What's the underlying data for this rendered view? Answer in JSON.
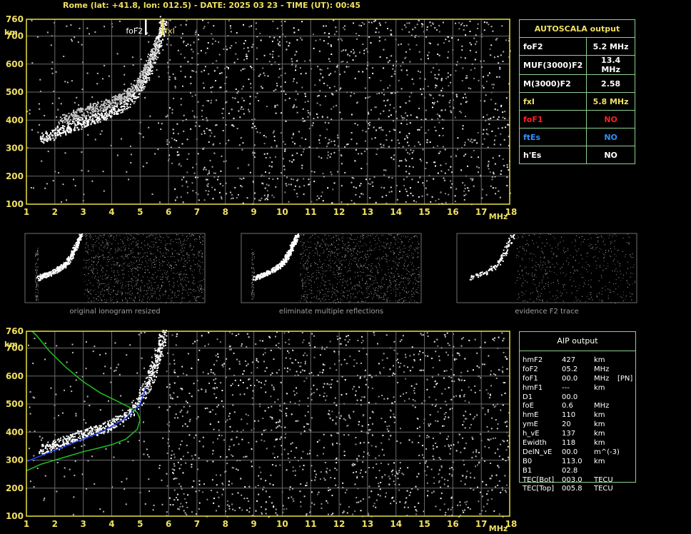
{
  "header": {
    "title": "Rome (lat: +41.8, lon: 012.5) - DATE: 2025 03 23 - TIME (UT): 00:45"
  },
  "chart_data": [
    {
      "type": "scatter",
      "title": "",
      "xlabel": "MHz",
      "ylabel": "km",
      "xlim": [
        1,
        18
      ],
      "ylim": [
        100,
        760
      ],
      "x_ticks": [
        "1",
        "2",
        "3",
        "4",
        "5",
        "6",
        "7",
        "8",
        "9",
        "10",
        "11",
        "12",
        "13",
        "14",
        "15",
        "16",
        "17",
        "18"
      ],
      "y_ticks": [
        "760",
        "700",
        "600",
        "500",
        "400",
        "300",
        "200",
        "100"
      ],
      "grid": true,
      "annotations": [
        {
          "text": "foF2",
          "x": 5.2,
          "color": "#ffffff"
        },
        {
          "text": "fxI",
          "x": 5.8,
          "color": "#f0e060"
        }
      ],
      "series": [
        {
          "x": [
            1.5,
            2.0,
            2.5,
            3.0,
            3.5,
            4.0,
            4.5,
            5.0,
            5.3,
            5.5,
            5.7,
            5.8
          ],
          "y": [
            335,
            355,
            375,
            395,
            410,
            430,
            460,
            520,
            580,
            640,
            700,
            760
          ],
          "color": "#ffffff"
        },
        {
          "x": [
            2.2,
            2.7,
            3.2,
            3.7,
            4.2,
            4.6,
            5.0,
            5.3,
            5.6
          ],
          "y": [
            400,
            420,
            440,
            455,
            475,
            500,
            540,
            600,
            680
          ],
          "color": "#c8c8c8"
        }
      ]
    },
    {
      "type": "scatter",
      "title": "",
      "xlabel": "MHz",
      "ylabel": "km",
      "xlim": [
        1,
        18
      ],
      "ylim": [
        100,
        760
      ],
      "x_ticks": [
        "1",
        "2",
        "3",
        "4",
        "5",
        "6",
        "7",
        "8",
        "9",
        "10",
        "11",
        "12",
        "13",
        "14",
        "15",
        "16",
        "17",
        "18"
      ],
      "y_ticks": [
        "760",
        "700",
        "600",
        "500",
        "400",
        "300",
        "200",
        "100"
      ],
      "grid": true,
      "series": [
        {
          "x": [
            1.5,
            2.0,
            2.5,
            3.0,
            3.5,
            4.0,
            4.5,
            5.0,
            5.3,
            5.5,
            5.7,
            5.8
          ],
          "y": [
            335,
            355,
            375,
            395,
            410,
            430,
            460,
            520,
            580,
            640,
            700,
            760
          ],
          "color": "#ffffff"
        },
        {
          "x": [
            1.0,
            1.5,
            2.0,
            2.5,
            3.0,
            3.5,
            4.0,
            4.5,
            5.0,
            5.2
          ],
          "y": [
            295,
            315,
            335,
            355,
            375,
            395,
            420,
            450,
            500,
            560
          ],
          "color": "#2040ff"
        },
        {
          "x": [
            1.0,
            1.5,
            2.0,
            2.5,
            3.0,
            3.5,
            4.0,
            4.5,
            4.9,
            5.0,
            4.9,
            4.6,
            4.2,
            3.6,
            3.0,
            2.4,
            1.8,
            1.4,
            1.2
          ],
          "y": [
            262,
            285,
            300,
            315,
            330,
            342,
            355,
            375,
            410,
            445,
            470,
            490,
            510,
            540,
            580,
            630,
            690,
            740,
            760
          ],
          "color": "#20c020"
        }
      ]
    }
  ],
  "autoscala": {
    "title": "AUTOSCALA output",
    "rows": [
      {
        "param": "foF2",
        "value": "5.2 MHz",
        "color": "white"
      },
      {
        "param": "MUF(3000)F2",
        "value": "13.4 MHz",
        "color": "white"
      },
      {
        "param": "M(3000)F2",
        "value": "2.58",
        "color": "white"
      },
      {
        "param": "fxI",
        "value": "5.8 MHz",
        "color": "yellow"
      },
      {
        "param": "foF1",
        "value": "NO",
        "color": "red"
      },
      {
        "param": "ftEs",
        "value": "NO",
        "color": "blue"
      },
      {
        "param": "h'Es",
        "value": "NO",
        "color": "white"
      }
    ]
  },
  "thumbnails": [
    {
      "label": "original ionogram resized"
    },
    {
      "label": "eliminate multiple reflections"
    },
    {
      "label": "evidence F2 trace"
    }
  ],
  "aip": {
    "title": "AIP output",
    "rows": [
      {
        "param": "hmF2",
        "value": "427",
        "unit": "km",
        "flag": ""
      },
      {
        "param": "foF2",
        "value": "05.2",
        "unit": "MHz",
        "flag": ""
      },
      {
        "param": "foF1",
        "value": "00.0",
        "unit": "MHz",
        "flag": "[PN]"
      },
      {
        "param": "hmF1",
        "value": "---",
        "unit": "km",
        "flag": ""
      },
      {
        "param": "D1",
        "value": "00.0",
        "unit": "",
        "flag": ""
      },
      {
        "param": "foE",
        "value": "0.6",
        "unit": "MHz",
        "flag": ""
      },
      {
        "param": "hmE",
        "value": "110",
        "unit": "km",
        "flag": ""
      },
      {
        "param": "ymE",
        "value": "20",
        "unit": "km",
        "flag": ""
      },
      {
        "param": "h_vE",
        "value": "137",
        "unit": "km",
        "flag": ""
      },
      {
        "param": "Ewidth",
        "value": "118",
        "unit": "km",
        "flag": ""
      },
      {
        "param": "DelN_vE",
        "value": "00.0",
        "unit": "m^(-3)",
        "flag": ""
      },
      {
        "param": "B0",
        "value": "113.0",
        "unit": "km",
        "flag": ""
      },
      {
        "param": "B1",
        "value": "02.8",
        "unit": "",
        "flag": ""
      },
      {
        "param": "TEC[Bot]",
        "value": "003.0",
        "unit": "TECU",
        "flag": ""
      },
      {
        "param": "TEC[Top]",
        "value": "005.8",
        "unit": "TECU",
        "flag": ""
      }
    ]
  }
}
